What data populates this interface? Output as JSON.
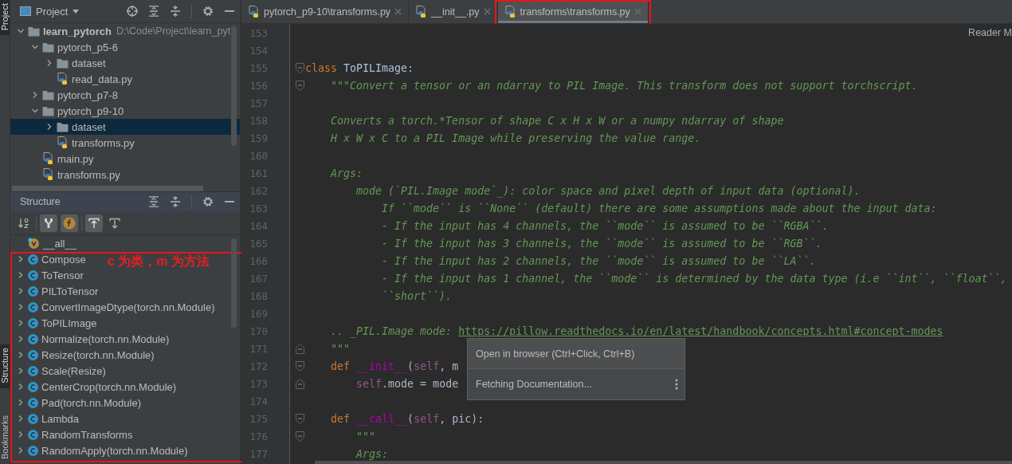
{
  "side_strip": [
    {
      "label": "Project",
      "selected": true
    },
    {
      "label": "Structure",
      "selected": true
    },
    {
      "label": "Bookmarks",
      "selected": false
    }
  ],
  "project_panel": {
    "title": "Project",
    "tree": [
      {
        "label": "learn_pytorch",
        "kind": "folder",
        "root": true,
        "path": "D:\\Code\\Project\\learn_pyt",
        "expanded": true,
        "selected": false,
        "children": [
          {
            "label": "pytorch_p5-6",
            "kind": "folder",
            "expanded": true,
            "selected": false,
            "children": [
              {
                "label": "dataset",
                "kind": "folder",
                "expanded": false,
                "selected": false
              },
              {
                "label": "read_data.py",
                "kind": "python",
                "selected": false
              }
            ]
          },
          {
            "label": "pytorch_p7-8",
            "kind": "folder",
            "expanded": false,
            "selected": false
          },
          {
            "label": "pytorch_p9-10",
            "kind": "folder",
            "expanded": true,
            "selected": false,
            "children": [
              {
                "label": "dataset",
                "kind": "folder",
                "expanded": false,
                "selected": true
              },
              {
                "label": "transforms.py",
                "kind": "python",
                "selected": false
              }
            ]
          },
          {
            "label": "main.py",
            "kind": "python",
            "selected": false
          },
          {
            "label": "transforms.py",
            "kind": "python",
            "selected": false
          }
        ]
      }
    ]
  },
  "structure_panel": {
    "title": "Structure",
    "highlighted": true,
    "note": "c 为类，m 为方法",
    "toolbar": [
      {
        "kind": "sort",
        "selected": false
      },
      {
        "kind": "inherited",
        "selected": true
      },
      {
        "kind": "fields",
        "selected": true
      },
      {
        "kind": "scroll-to",
        "selected": true
      },
      {
        "kind": "scroll-from",
        "selected": false
      }
    ],
    "items": [
      {
        "label": "__all__",
        "kind": "variable"
      },
      {
        "label": "Compose",
        "kind": "class",
        "expanded": false
      },
      {
        "label": "ToTensor",
        "kind": "class",
        "expanded": false
      },
      {
        "label": "PILToTensor",
        "kind": "class",
        "expanded": false
      },
      {
        "label": "ConvertImageDtype(torch.nn.Module)",
        "kind": "class",
        "expanded": false
      },
      {
        "label": "ToPILImage",
        "kind": "class",
        "expanded": false
      },
      {
        "label": "Normalize(torch.nn.Module)",
        "kind": "class",
        "expanded": false
      },
      {
        "label": "Resize(torch.nn.Module)",
        "kind": "class",
        "expanded": false
      },
      {
        "label": "Scale(Resize)",
        "kind": "class",
        "expanded": false
      },
      {
        "label": "CenterCrop(torch.nn.Module)",
        "kind": "class",
        "expanded": false
      },
      {
        "label": "Pad(torch.nn.Module)",
        "kind": "class",
        "expanded": false
      },
      {
        "label": "Lambda",
        "kind": "class",
        "expanded": false
      },
      {
        "label": "RandomTransforms",
        "kind": "class",
        "expanded": false
      },
      {
        "label": "RandomApply(torch.nn.Module)",
        "kind": "class",
        "expanded": false
      }
    ]
  },
  "editor": {
    "tabs": [
      {
        "label": "pytorch_p9-10\\transforms.py",
        "selected": false,
        "highlighted": false
      },
      {
        "label": "__init__.py",
        "selected": false,
        "highlighted": false
      },
      {
        "label": "transforms\\transforms.py",
        "selected": true,
        "highlighted": true
      }
    ],
    "reader_mode": "Reader M",
    "lines": [
      {
        "number": "153"
      },
      {
        "number": "154"
      },
      {
        "number": "155",
        "fold_start": true,
        "tokens": [
          {
            "kind": "keyword",
            "text": "class"
          },
          {
            "kind": "classname",
            "text": " ToPILImage"
          },
          {
            "kind": "plain",
            "text": ":"
          }
        ]
      },
      {
        "number": "156",
        "fold_start": true,
        "tokens": [
          {
            "kind": "doc",
            "text": "    \"\"\"Convert a tensor or an ndarray to PIL Image. This transform does not support torchscript."
          }
        ]
      },
      {
        "number": "157"
      },
      {
        "number": "158",
        "tokens": [
          {
            "kind": "doc",
            "text": "    Converts a torch.*Tensor of shape C x H x W or a numpy ndarray of shape"
          }
        ]
      },
      {
        "number": "159",
        "tokens": [
          {
            "kind": "doc",
            "text": "    H x W x C to a PIL Image while preserving the value range."
          }
        ]
      },
      {
        "number": "160"
      },
      {
        "number": "161",
        "tokens": [
          {
            "kind": "doc",
            "text": "    Args:"
          }
        ]
      },
      {
        "number": "162",
        "tokens": [
          {
            "kind": "doc",
            "text": "        mode (`PIL.Image mode`_): color space and pixel depth of input data (optional)."
          }
        ]
      },
      {
        "number": "163",
        "tokens": [
          {
            "kind": "doc",
            "text": "            If ``mode`` is ``None`` (default) there are some assumptions made about the input data:"
          }
        ]
      },
      {
        "number": "164",
        "tokens": [
          {
            "kind": "doc",
            "text": "            - If the input has 4 channels, the ``mode`` is assumed to be ``RGBA``."
          }
        ]
      },
      {
        "number": "165",
        "tokens": [
          {
            "kind": "doc",
            "text": "            - If the input has 3 channels, the ``mode`` is assumed to be ``RGB``."
          }
        ]
      },
      {
        "number": "166",
        "tokens": [
          {
            "kind": "doc",
            "text": "            - If the input has 2 channels, the ``mode`` is assumed to be ``LA``."
          }
        ]
      },
      {
        "number": "167",
        "tokens": [
          {
            "kind": "doc",
            "text": "            - If the input has 1 channel, the ``mode`` is determined by the data type (i.e ``int``, ``float``,"
          }
        ]
      },
      {
        "number": "168",
        "tokens": [
          {
            "kind": "doc",
            "text": "            ``short``)."
          }
        ]
      },
      {
        "number": "169"
      },
      {
        "number": "170",
        "tokens": [
          {
            "kind": "doc",
            "text": "    .. _PIL.Image mode: "
          },
          {
            "kind": "link",
            "text": "https://pillow.readthedocs.io/en/latest/handbook/concepts.html#concept-modes"
          }
        ]
      },
      {
        "number": "171",
        "fold_end": true,
        "tokens": [
          {
            "kind": "doc",
            "text": "    \"\"\""
          }
        ]
      },
      {
        "number": "172",
        "fold_start": true,
        "tokens": [
          {
            "kind": "keyword",
            "text": "    def"
          },
          {
            "kind": "magic",
            "text": " __init__"
          },
          {
            "kind": "plain",
            "text": "("
          },
          {
            "kind": "self",
            "text": "self"
          },
          {
            "kind": "plain",
            "text": ", m"
          }
        ]
      },
      {
        "number": "173",
        "fold_end": true,
        "tokens": [
          {
            "kind": "self",
            "text": "        self"
          },
          {
            "kind": "plain",
            "text": ".mode = mode"
          }
        ]
      },
      {
        "number": "174"
      },
      {
        "number": "175",
        "fold_start": true,
        "tokens": [
          {
            "kind": "keyword",
            "text": "    def"
          },
          {
            "kind": "magic",
            "text": " __call__"
          },
          {
            "kind": "plain",
            "text": "("
          },
          {
            "kind": "self",
            "text": "self"
          },
          {
            "kind": "plain",
            "text": ", pic):"
          }
        ]
      },
      {
        "number": "176",
        "fold_start": true,
        "tokens": [
          {
            "kind": "doc",
            "text": "        \"\"\""
          }
        ]
      },
      {
        "number": "177",
        "tokens": [
          {
            "kind": "doc",
            "text": "        Args:"
          }
        ]
      }
    ]
  },
  "popup": {
    "items": [
      {
        "label": "Open in browser (Ctrl+Click, Ctrl+B)",
        "kind": "action"
      },
      {
        "label": "Fetching Documentation...",
        "kind": "status"
      }
    ]
  }
}
